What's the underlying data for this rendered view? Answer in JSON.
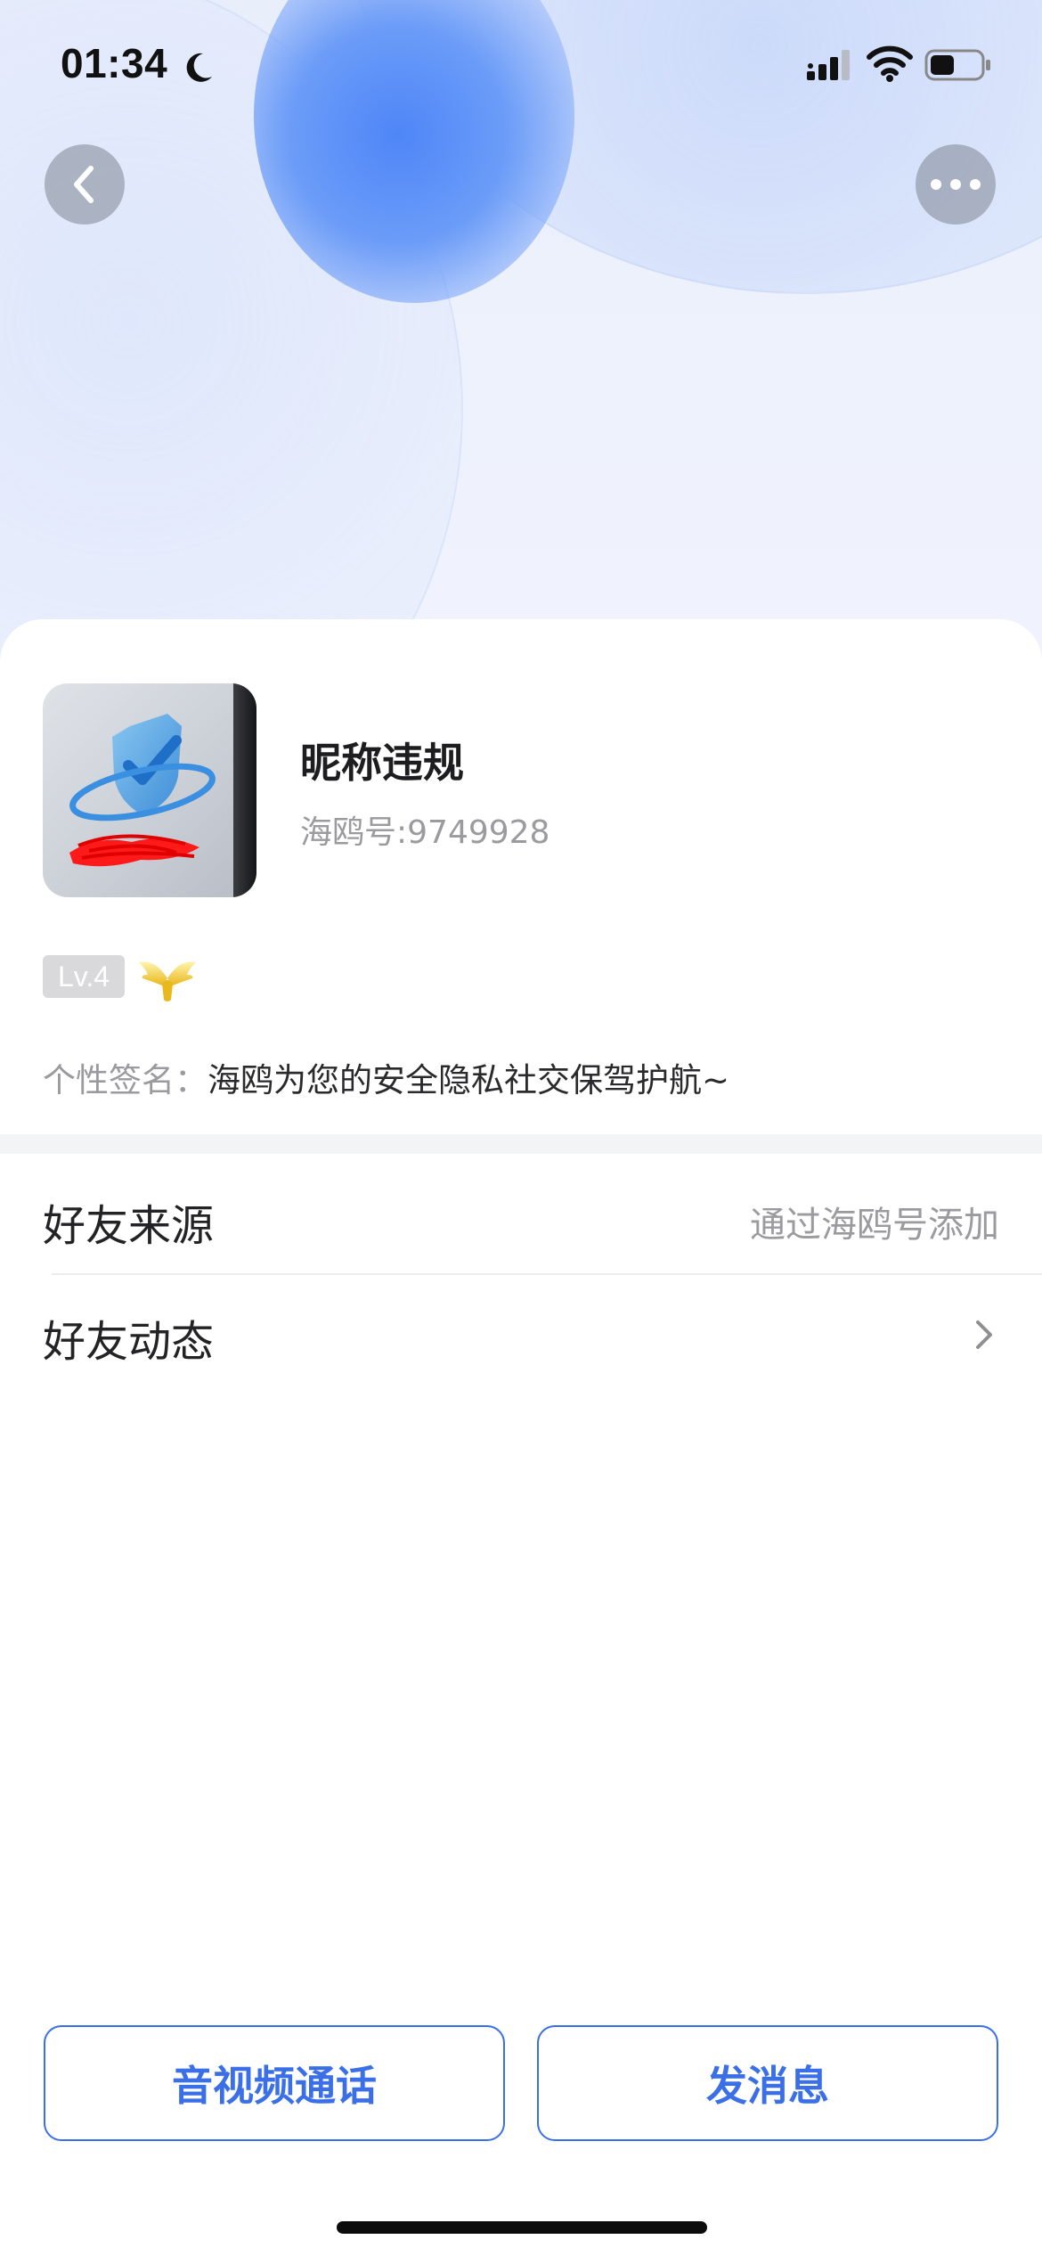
{
  "status_bar": {
    "time": "01:34",
    "icons": [
      "moon-icon",
      "signal-icon",
      "wifi-icon",
      "battery-icon"
    ]
  },
  "nav": {
    "back_icon": "chevron-left-icon",
    "more_icon": "more-dots-icon"
  },
  "profile": {
    "avatar_icon": "shield-check-icon",
    "nickname": "昵称违规",
    "account_id": "海鸥号:9749928",
    "level": "Lv.4",
    "level_icon": "wings-icon",
    "signature_label": "个性签名：",
    "signature": "海鸥为您的安全隐私社交保驾护航~"
  },
  "rows": {
    "source_title": "好友来源",
    "source_value": "通过海鸥号添加",
    "moments_title": "好友动态"
  },
  "actions": {
    "call_label": "音视频通话",
    "message_label": "发消息"
  },
  "colors": {
    "accent": "#3a6fe8",
    "secondary_text": "#9a9a9f",
    "hero_bubble": "#4f86f7",
    "section_divider": "#f3f4f6"
  }
}
